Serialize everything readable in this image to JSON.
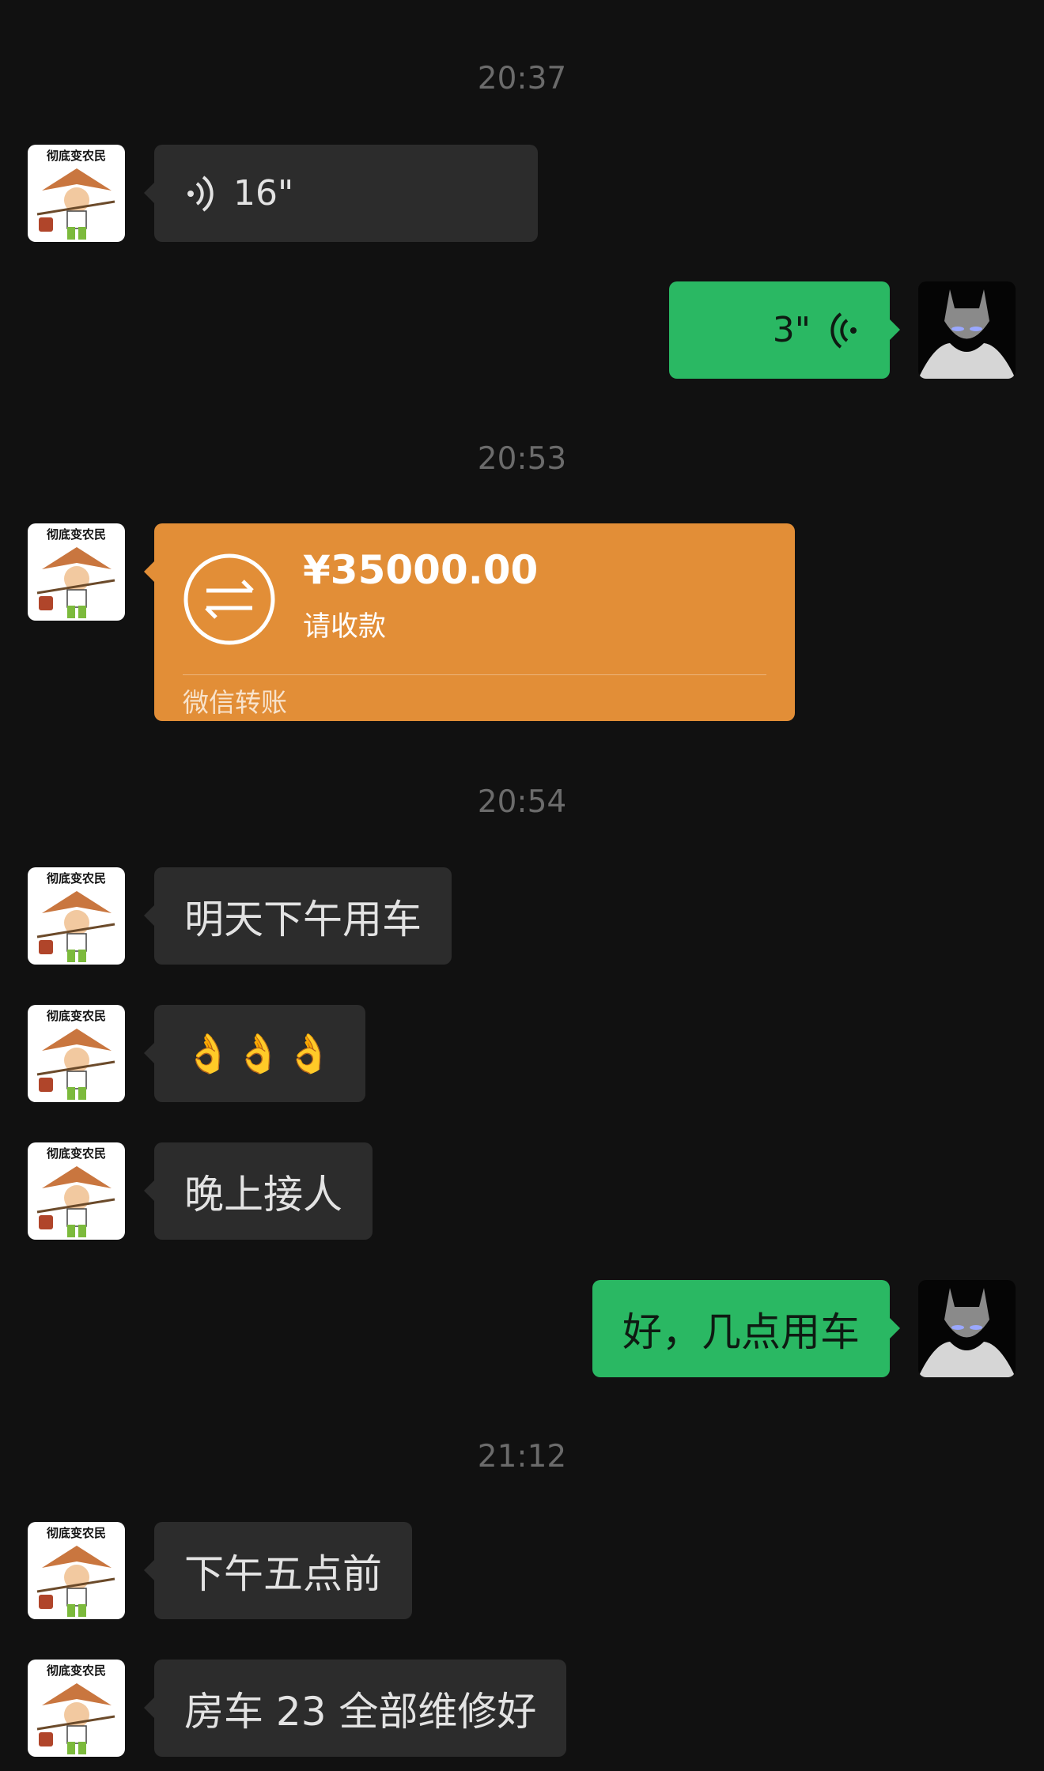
{
  "timestamps": [
    "20:37",
    "20:53",
    "20:54",
    "21:12"
  ],
  "avatars": {
    "contact_caption": "彻底变农民"
  },
  "messages": {
    "voice_in": {
      "duration": "16\""
    },
    "voice_out": {
      "duration": "3\""
    },
    "transfer": {
      "amount": "¥35000.00",
      "status": "请收款",
      "footer": "微信转账"
    },
    "msg1": "明天下午用车",
    "msg2": "👌👌👌",
    "msg3": "晚上接人",
    "reply1": "好，几点用车",
    "msg4": "下午五点前",
    "msg5": "房车 23 全部维修好"
  },
  "colors": {
    "background": "#111111",
    "incoming_bubble": "#2c2c2c",
    "outgoing_bubble": "#2ab863",
    "transfer_card": "#e28e37"
  }
}
